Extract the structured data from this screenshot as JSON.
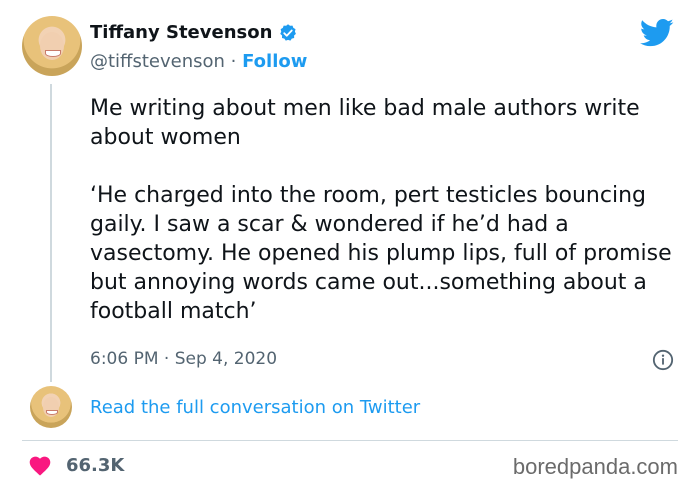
{
  "author": {
    "name": "Tiffany Stevenson",
    "handle": "@tiffstevenson",
    "separator": "·",
    "follow_label": "Follow"
  },
  "tweet": {
    "text": "Me writing about men like bad male authors write about women\n\n‘He charged into the room, pert testicles bouncing gaily. I saw a scar & wondered if he’d had a vasectomy.  He opened his plump lips, full of promise but annoying words came out...something about a football match’",
    "timestamp": "6:06 PM · Sep 4, 2020"
  },
  "conversation_link": "Read the full conversation on Twitter",
  "likes_count": "66.3K",
  "watermark": "boredpanda.com",
  "icons": {
    "verified": "verified-badge-icon",
    "logo": "twitter-bird-icon",
    "info": "info-icon",
    "like": "heart-icon"
  },
  "colors": {
    "accent": "#1d9bf0",
    "heart": "#f91880",
    "muted": "#536471",
    "text": "#0f1419"
  }
}
